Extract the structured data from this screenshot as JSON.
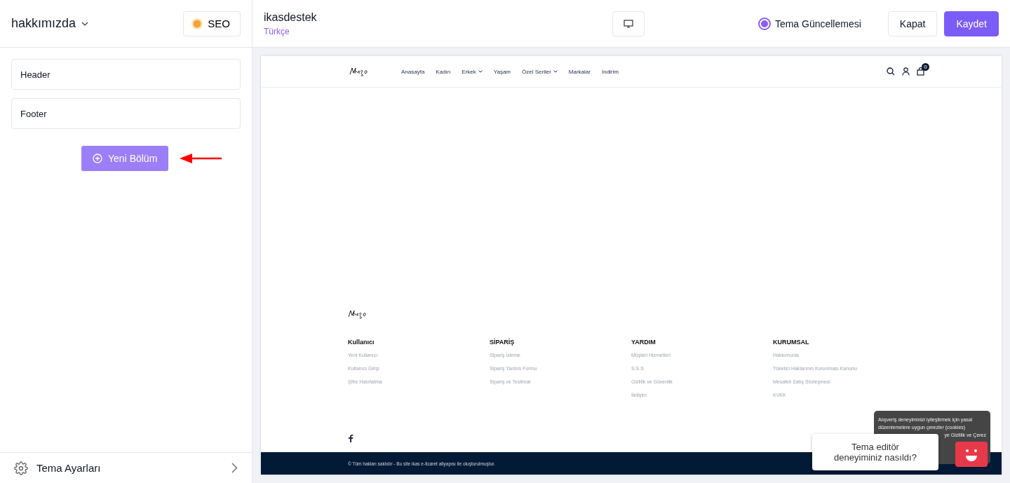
{
  "sidebar": {
    "page_title": "hakkımızda",
    "seo_button": "SEO",
    "sections": [
      {
        "label": "Header"
      },
      {
        "label": "Footer"
      }
    ],
    "new_section_button": "Yeni Bölüm",
    "settings": "Tema Ayarları"
  },
  "topbar": {
    "store_name": "ikasdestek",
    "language": "Türkçe",
    "theme_update": {
      "label": "Tema Güncellemesi",
      "on": true
    },
    "close_button": "Kapat",
    "save_button": "Kaydet"
  },
  "preview": {
    "nav": [
      {
        "label": "Anasayfa",
        "dropdown": false
      },
      {
        "label": "Kadın",
        "dropdown": false
      },
      {
        "label": "Erkek",
        "dropdown": true
      },
      {
        "label": "Yaşam",
        "dropdown": false
      },
      {
        "label": "Özel Seriler",
        "dropdown": true
      },
      {
        "label": "Markalar",
        "dropdown": false
      },
      {
        "label": "İndirim",
        "dropdown": false
      }
    ],
    "cart_count": "0",
    "footer_columns": [
      {
        "title": "Kullanıcı",
        "links": [
          "Yeni Kullanıcı",
          "Kullanıcı Girişi",
          "Şifre Hatırlatma"
        ]
      },
      {
        "title": "SİPARİŞ",
        "links": [
          "Sipariş İzleme",
          "Sipariş Yardım Formu",
          "Sipariş ve Teslimat"
        ]
      },
      {
        "title": "YARDIM",
        "links": [
          "Müşteri Hizmetleri",
          "S.S.S",
          "Gizlilik ve Güvenlik",
          "İletişim"
        ]
      },
      {
        "title": "KURUMSAL",
        "links": [
          "Hakkımızda",
          "Tüketici Haklarının Korunması Kanunu",
          "Mesafeli Satış Sözleşmesi",
          "KVKK"
        ]
      }
    ],
    "copyright": "© Tüm hakları saklıdır - Bu site ikas e-ticaret altyapısı ile oluşturulmuştur.",
    "cookie_lines": [
      "Alışveriş deneyiminizi iyileştirmek için yasal",
      "düzenlemelere uygun çerezler (cookies)",
      "ye Gizlilik ve Çerez"
    ]
  },
  "feedback": {
    "question": "Tema editör deneyiminiz nasıldı?"
  }
}
